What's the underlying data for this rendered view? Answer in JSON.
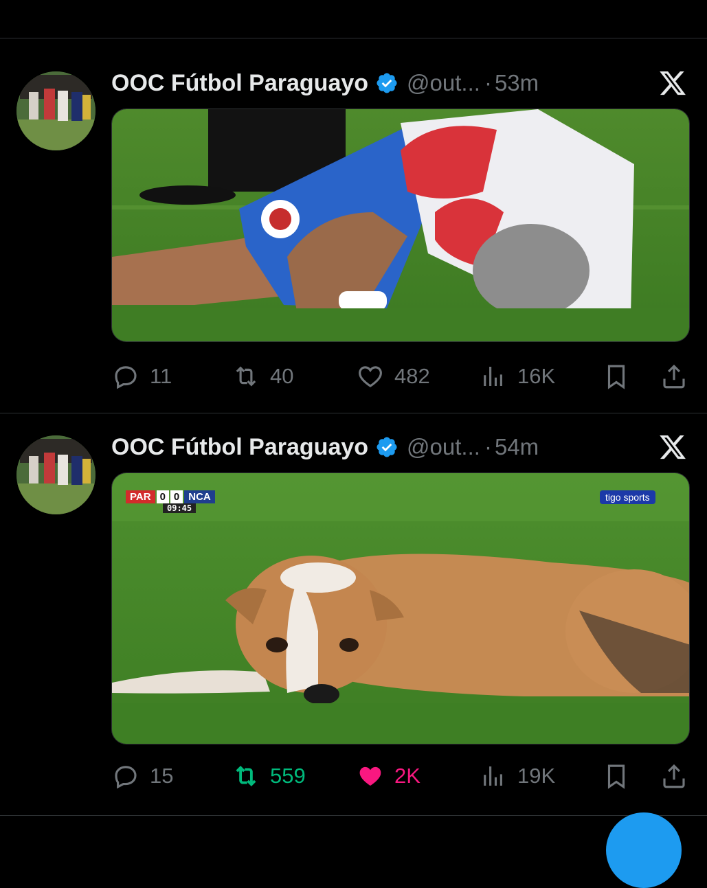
{
  "tweets": [
    {
      "name": "OOC Fútbol Paraguayo",
      "handle": "@out...",
      "time": "53m",
      "replies": "11",
      "reposts": "40",
      "likes": "482",
      "views": "16K",
      "reposted": false,
      "liked": false
    },
    {
      "name": "OOC Fútbol Paraguayo",
      "handle": "@out...",
      "time": "54m",
      "replies": "15",
      "reposts": "559",
      "likes": "2K",
      "views": "19K",
      "reposted": true,
      "liked": true,
      "scorebug": {
        "home": "PAR",
        "home_score": "0",
        "away_score": "0",
        "away": "NCA",
        "clock": "09:45",
        "broadcaster": "tigo sports"
      }
    }
  ],
  "colors": {
    "background": "#000000",
    "text": "#e7e9ea",
    "muted": "#71767b",
    "verified": "#1d9bf0",
    "repost_active": "#00ba7c",
    "like_active": "#f91880",
    "divider": "#2f3336"
  },
  "icons": [
    "verified-badge-icon",
    "x-logo-icon",
    "reply-icon",
    "repost-icon",
    "like-icon",
    "views-icon",
    "bookmark-icon",
    "share-icon"
  ]
}
